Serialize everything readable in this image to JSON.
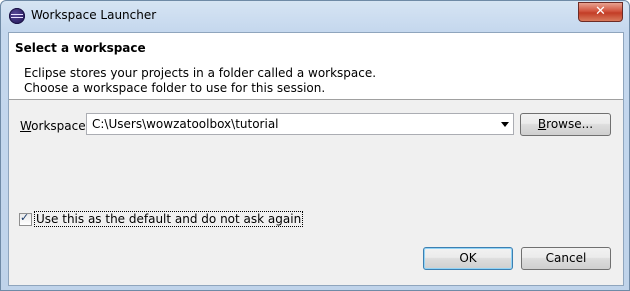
{
  "window": {
    "title": "Workspace Launcher",
    "close_glyph": "✕",
    "icon": "eclipse-icon"
  },
  "banner": {
    "title": "Select a workspace",
    "description_line1": "Eclipse stores your projects in a folder called a workspace.",
    "description_line2": "Choose a workspace folder to use for this session."
  },
  "workspace": {
    "label_mnemonic": "W",
    "label_rest": "orkspace:",
    "value": "C:\\Users\\wowzatoolbox\\tutorial",
    "browse_mnemonic": "B",
    "browse_rest": "rowse..."
  },
  "default_option": {
    "label": "Use this as the default and do not ask again",
    "checked": true,
    "check_glyph": "✓"
  },
  "buttons": {
    "ok": "OK",
    "cancel": "Cancel"
  }
}
